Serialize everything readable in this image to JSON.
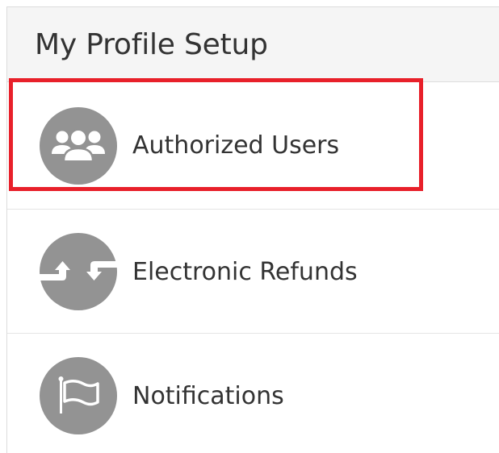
{
  "panel": {
    "title": "My Profile Setup"
  },
  "menu": {
    "items": [
      {
        "label": "Authorized Users",
        "icon": "users-group-icon",
        "highlighted": true
      },
      {
        "label": "Electronic Refunds",
        "icon": "exchange-arrows-icon",
        "highlighted": false
      },
      {
        "label": "Notifications",
        "icon": "flag-icon",
        "highlighted": false
      }
    ]
  },
  "colors": {
    "icon_background": "#939393",
    "highlight_border": "#e8202a",
    "header_background": "#f5f5f5",
    "text": "#333333"
  }
}
